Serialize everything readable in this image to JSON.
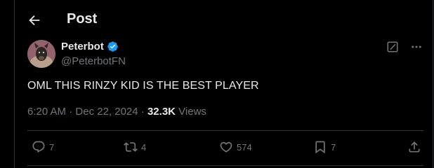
{
  "header": {
    "title": "Post",
    "back_icon": "arrow-left-icon"
  },
  "post": {
    "author_name": "Peterbot",
    "author_handle": "@PeterbotFN",
    "verified": true,
    "text": "OML THIS RINZY KID IS THE BEST PLAYER",
    "time": "6:20 AM",
    "date": "Dec 22, 2024",
    "views_count": "32.3K",
    "views_label": "Views"
  },
  "actions": {
    "replies": "7",
    "reposts": "4",
    "likes": "574",
    "bookmarks": "7"
  },
  "colors": {
    "background": "#000000",
    "text": "#e7e9ea",
    "muted": "#71767b",
    "verified": "#1d9bf0",
    "divider": "#2f3336"
  }
}
